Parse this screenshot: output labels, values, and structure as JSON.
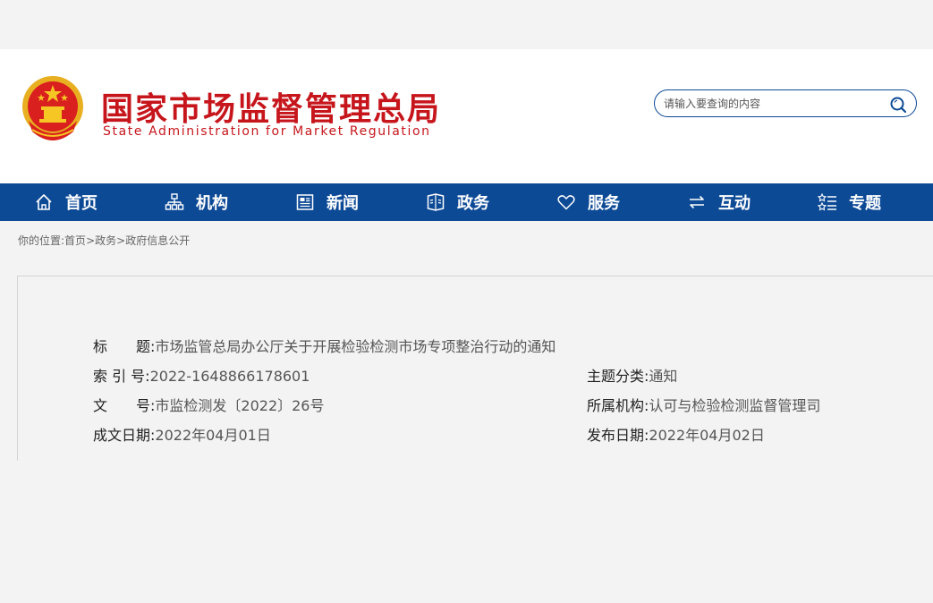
{
  "header": {
    "title": "国家市场监督管理总局",
    "subtitle": "State Administration for Market Regulation",
    "emblem_icon": "national-emblem-icon"
  },
  "search": {
    "placeholder": "请输入要查询的内容",
    "icon": "search-icon"
  },
  "nav": {
    "items": [
      {
        "label": "首页",
        "icon": "home-icon"
      },
      {
        "label": "机构",
        "icon": "org-chart-icon"
      },
      {
        "label": "新闻",
        "icon": "news-icon"
      },
      {
        "label": "政务",
        "icon": "government-affairs-icon"
      },
      {
        "label": "服务",
        "icon": "heart-icon"
      },
      {
        "label": "互动",
        "icon": "exchange-icon"
      },
      {
        "label": "专题",
        "icon": "topic-list-icon"
      }
    ]
  },
  "breadcrumb": {
    "prefix": "你的位置:",
    "items": [
      "首页",
      "政务",
      "政府信息公开"
    ],
    "separator": ">"
  },
  "document": {
    "title_label": "标　　题:",
    "title_value": "市场监管总局办公厅关于开展检验检测市场专项整治行动的通知",
    "index_label": "索 引 号:",
    "index_value": "2022-1648866178601",
    "category_label": "主题分类:",
    "category_value": "通知",
    "docno_label": "文　　号:",
    "docno_value": "市监检测发〔2022〕26号",
    "org_label": "所属机构:",
    "org_value": "认可与检验检测监督管理司",
    "written_label": "成文日期:",
    "written_value": "2022年04月01日",
    "published_label": "发布日期:",
    "published_value": "2022年04月02日"
  },
  "colors": {
    "brand_red": "#c6161c",
    "nav_blue": "#0d4a96",
    "background": "#f3f3f3"
  }
}
